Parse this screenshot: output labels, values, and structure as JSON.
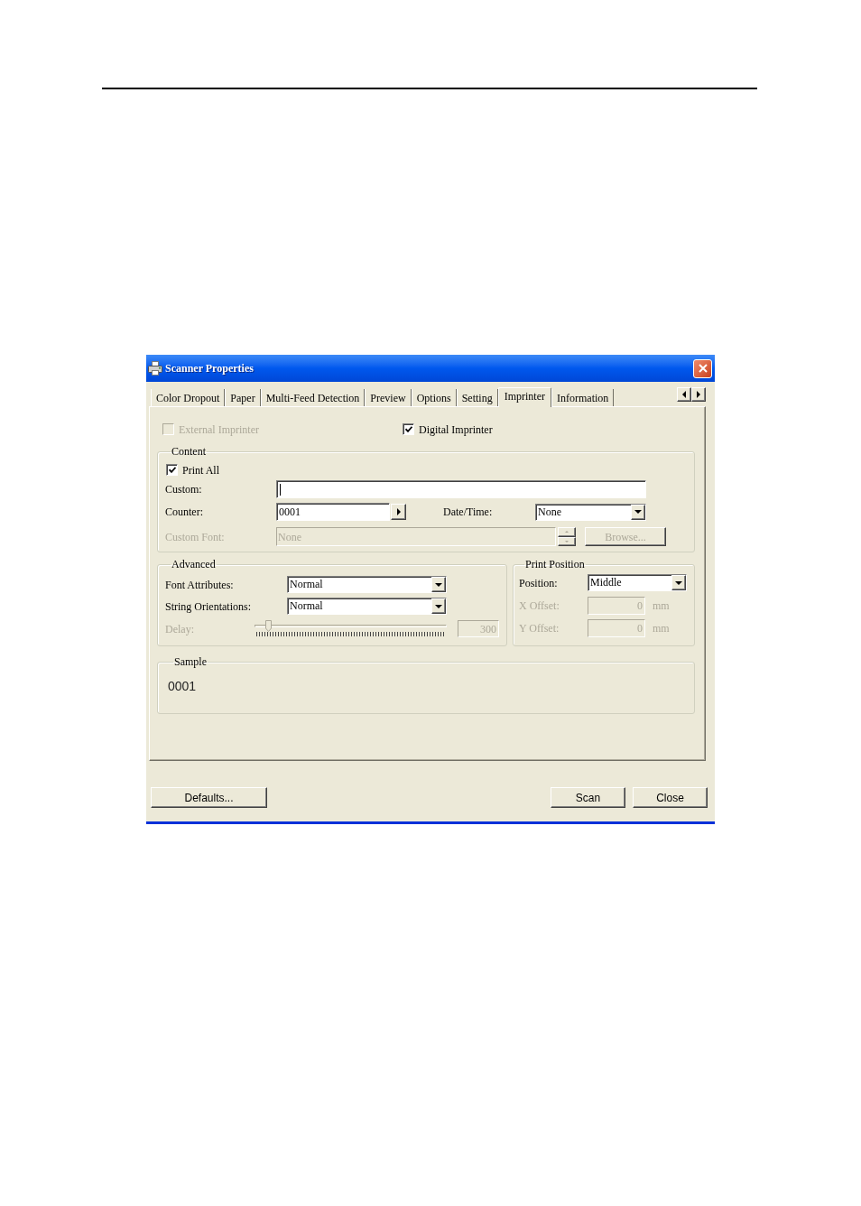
{
  "window": {
    "title": "Scanner Properties"
  },
  "tabs": [
    {
      "label": "Color Dropout",
      "selected": false
    },
    {
      "label": "Paper",
      "selected": false
    },
    {
      "label": "Multi-Feed Detection",
      "selected": false
    },
    {
      "label": "Preview",
      "selected": false
    },
    {
      "label": "Options",
      "selected": false
    },
    {
      "label": "Setting",
      "selected": false
    },
    {
      "label": "Imprinter",
      "selected": true
    },
    {
      "label": "Information",
      "selected": false
    }
  ],
  "imprinters": [
    {
      "label": "External Imprinter",
      "checked": false,
      "disabled": true
    },
    {
      "label": "Digital Imprinter",
      "checked": true,
      "disabled": false
    }
  ],
  "content": {
    "title": "Content",
    "print_all": {
      "label": "Print All",
      "checked": true
    },
    "custom": {
      "label": "Custom:"
    },
    "counter": {
      "label": "Counter:",
      "value": "0001"
    },
    "date_time": {
      "label": "Date/Time:",
      "value": "None"
    },
    "custom_font": {
      "label": "Custom Font:",
      "value": "None",
      "disabled": true
    },
    "browse_button": {
      "label": "Browse...",
      "disabled": true
    }
  },
  "advanced": {
    "title": "Advanced",
    "font_attributes": {
      "label": "Font Attributes:",
      "value": "Normal"
    },
    "string_orientations": {
      "label": "String Orientations:",
      "value": "Normal"
    },
    "delay": {
      "label": "Delay:",
      "level": 0.06,
      "value": "300",
      "disabled": true
    }
  },
  "print_position": {
    "title": "Print Position",
    "position": {
      "label": "Position:",
      "value": "Middle"
    },
    "offsets": [
      {
        "label": "X Offset:",
        "value": "0",
        "unit": "mm",
        "disabled": true
      },
      {
        "label": "Y Offset:",
        "value": "0",
        "unit": "mm",
        "disabled": true
      }
    ]
  },
  "sample": {
    "title": "Sample",
    "text": "0001"
  },
  "footer": {
    "left_buttons": [
      {
        "label": "Defaults..."
      }
    ],
    "right_buttons": [
      {
        "label": "Scan"
      },
      {
        "label": "Close"
      }
    ]
  }
}
